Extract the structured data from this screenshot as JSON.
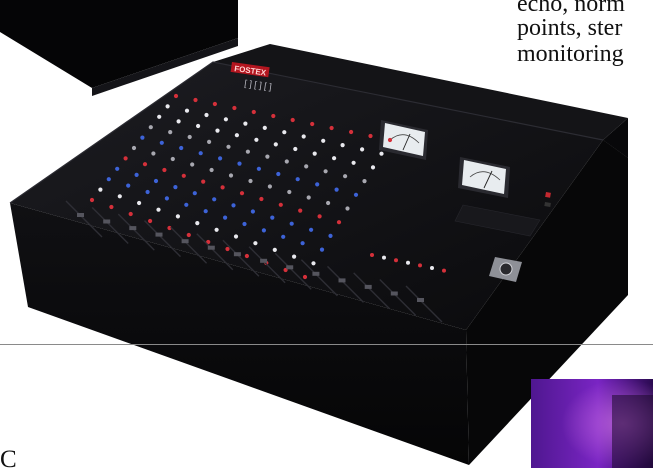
{
  "page": {
    "text_lines": [
      "echo, norm",
      "points, ster",
      "monitoring"
    ],
    "caption": "C"
  },
  "mixer": {
    "brand": "FOSTEX",
    "model": "[ ] [ ] [ ]",
    "channels": 12,
    "meters": 2,
    "colors": {
      "body": "#0b0b0d",
      "knob_white": "#e9e9ee",
      "knob_red": "#d5303a",
      "knob_blue": "#3d63d8",
      "knob_grey": "#a8a8b0",
      "meter_face": "#e8ecef"
    }
  },
  "inset_photo": {
    "colors": {
      "primary": "#6b1db4",
      "secondary": "#b35ad6"
    }
  }
}
